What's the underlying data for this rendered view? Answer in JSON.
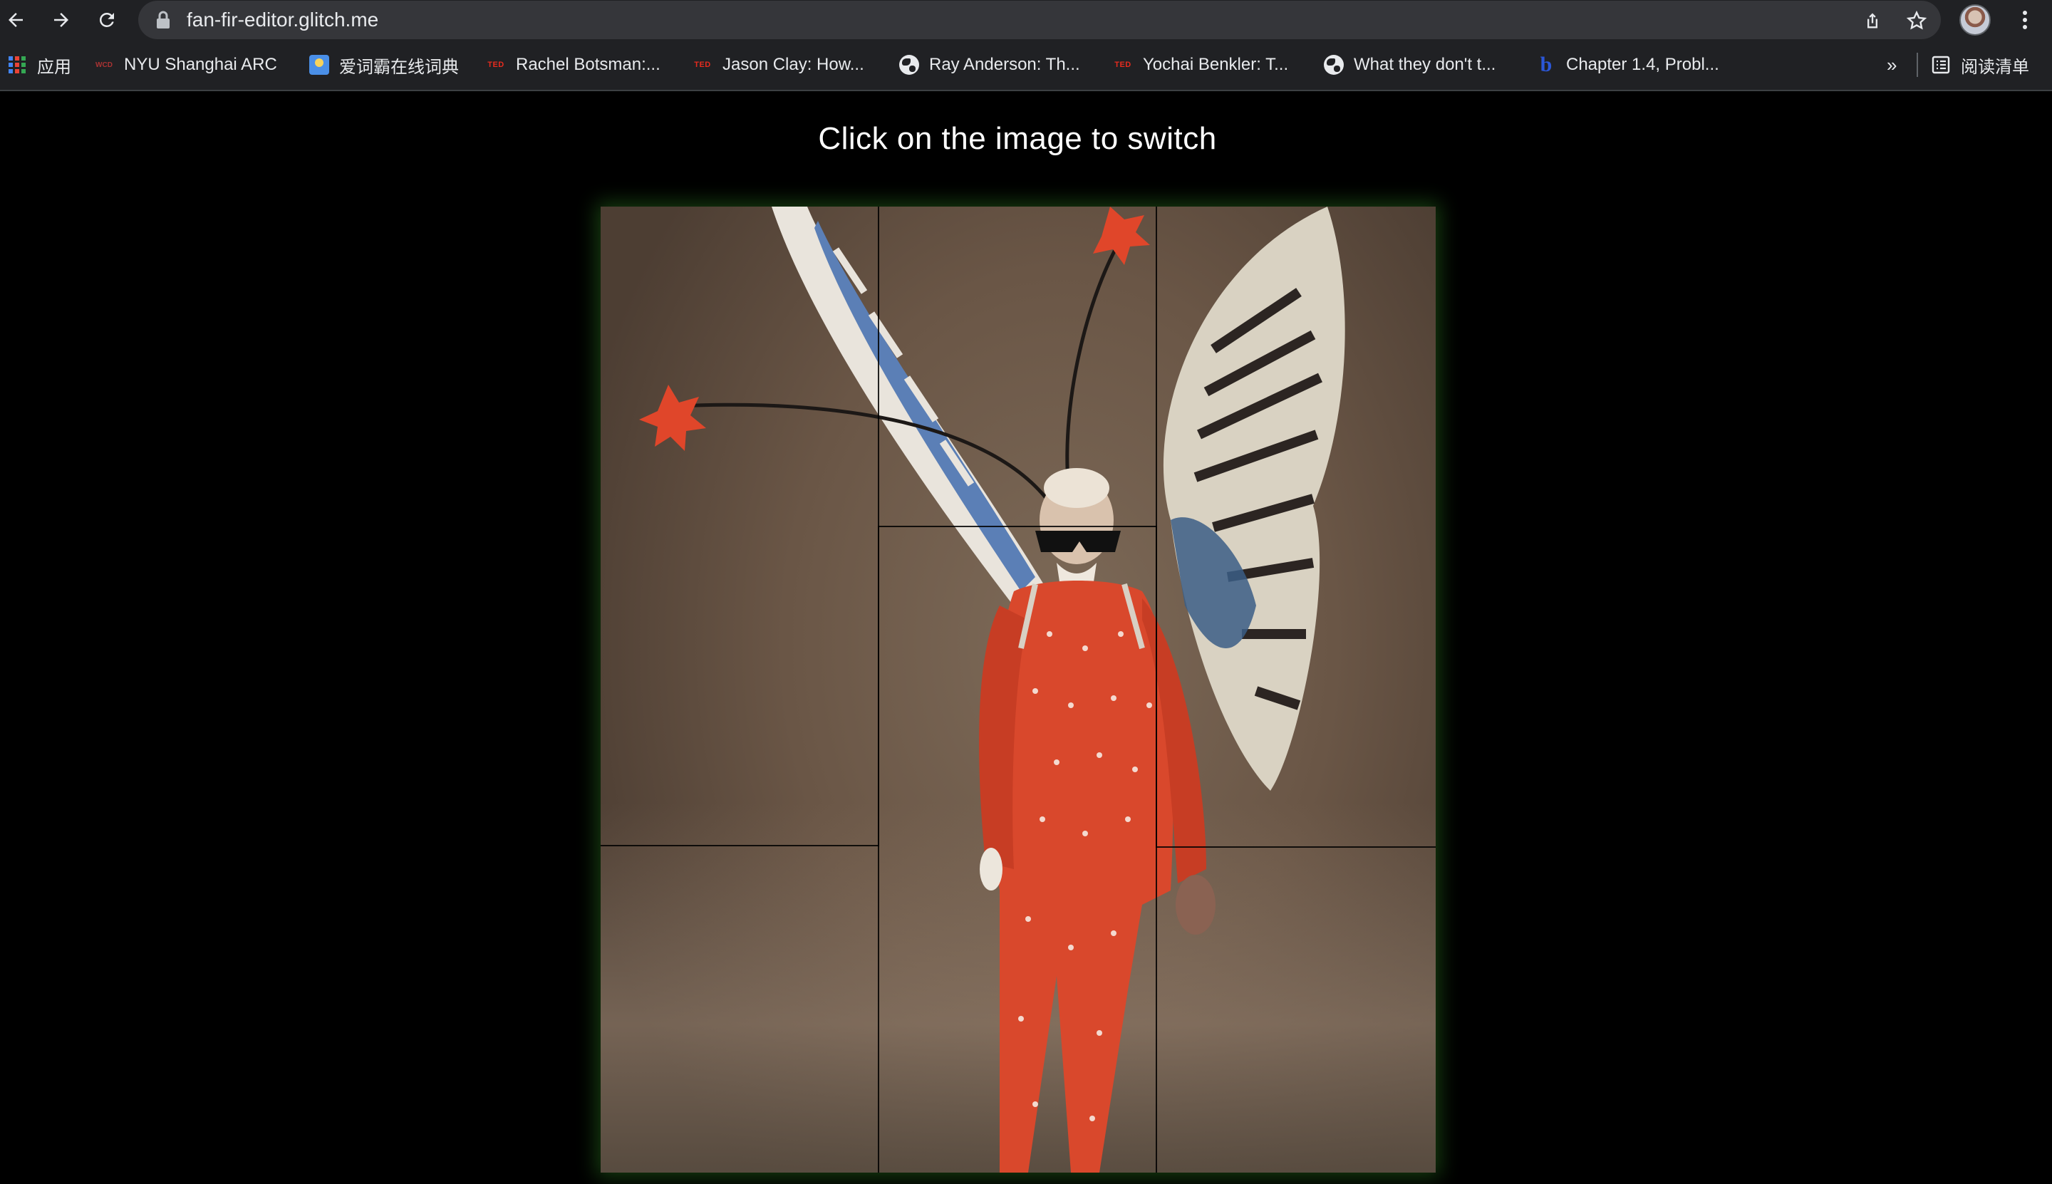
{
  "browser": {
    "url": "fan-fir-editor.glitch.me",
    "icons": {
      "back": "arrow-left-icon",
      "forward": "arrow-right-icon",
      "reload": "reload-icon",
      "lock": "lock-icon",
      "share": "share-icon",
      "star": "star-icon",
      "menu": "kebab-menu-icon"
    }
  },
  "bookmarks": {
    "apps_label": "应用",
    "items": [
      {
        "label": "NYU Shanghai ARC",
        "icon": "wcd-icon"
      },
      {
        "label": "爱词霸在线词典",
        "icon": "dictionary-icon"
      },
      {
        "label": "Rachel Botsman:...",
        "icon": "ted-icon"
      },
      {
        "label": "Jason Clay: How...",
        "icon": "ted-icon"
      },
      {
        "label": "Ray Anderson: Th...",
        "icon": "globe-icon"
      },
      {
        "label": "Yochai Benkler: T...",
        "icon": "ted-icon"
      },
      {
        "label": "What they don't t...",
        "icon": "globe-icon"
      },
      {
        "label": "Chapter 1.4, Probl...",
        "icon": "bing-icon"
      }
    ],
    "overflow_label": "»",
    "reading_list_label": "阅读清单"
  },
  "page": {
    "heading": "Click on the image to switch"
  },
  "colors": {
    "page_bg": "#000000",
    "chrome_bg": "#202124",
    "omnibox_bg": "#35363a",
    "glow": "#2d6e1e"
  }
}
